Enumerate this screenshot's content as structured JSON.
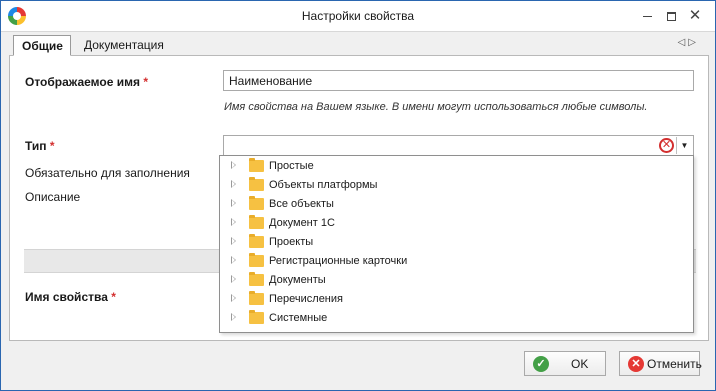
{
  "window": {
    "title": "Настройки свойства",
    "minimize_icon": "minimize-icon",
    "maximize_icon": "maximize-icon",
    "close_glyph": "✕"
  },
  "tabs": [
    {
      "label": "Общие",
      "active": true
    },
    {
      "label": "Документация",
      "active": false
    }
  ],
  "tab_nav": {
    "left": "◁",
    "right": "▷"
  },
  "form": {
    "display_name": {
      "label": "Отображаемое имя",
      "required_mark": "*",
      "value": "Наименование",
      "hint": "Имя свойства на Вашем языке. В имени могут использоваться любые символы."
    },
    "type": {
      "label": "Тип",
      "required_mark": "*",
      "value": "",
      "clear_glyph": "✕",
      "drop_glyph": "▼"
    },
    "required_field": {
      "label": "Обязательно для заполнения"
    },
    "description": {
      "label": "Описание"
    },
    "property_name": {
      "label": "Имя свойства",
      "required_mark": "*"
    }
  },
  "type_dropdown": {
    "items": [
      "Простые",
      "Объекты платформы",
      "Все объекты",
      "Документ 1С",
      "Проекты",
      "Регистрационные карточки",
      "Документы",
      "Перечисления",
      "Системные"
    ]
  },
  "buttons": {
    "ok": {
      "label": "OK",
      "icon_glyph": "✓"
    },
    "cancel": {
      "label": "Отменить",
      "icon_glyph": "✕"
    }
  },
  "colors": {
    "required": "#d32f2f",
    "ok_icon": "#43a047",
    "cancel_icon": "#e53935",
    "folder": "#f6c142"
  }
}
